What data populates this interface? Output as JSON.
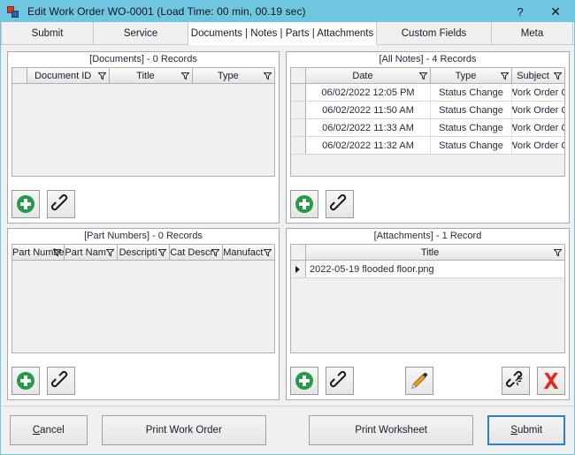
{
  "window": {
    "title": "Edit Work Order WO-0001 (Load Time: 00 min, 00.19 sec)",
    "help_label": "?",
    "close_label": "✕",
    "titlebar_color": "#6fc6e0"
  },
  "tabs": [
    {
      "label": "Submit",
      "active": false
    },
    {
      "label": "Service",
      "active": false
    },
    {
      "label": "Documents | Notes | Parts | Attachments",
      "active": true
    },
    {
      "label": "Custom Fields",
      "active": false
    },
    {
      "label": "Meta",
      "active": false
    }
  ],
  "panels": {
    "documents": {
      "title": "[Documents] - 0 Records",
      "columns": [
        "Document ID",
        "Title",
        "Type"
      ],
      "rows": [],
      "toolbar": [
        {
          "name": "add-button",
          "icon": "plus-circle-icon"
        },
        {
          "name": "link-button",
          "icon": "link-icon"
        }
      ]
    },
    "notes": {
      "title": "[All Notes] - 4 Records",
      "columns": [
        "Date",
        "Type",
        "Subject"
      ],
      "rows": [
        [
          "06/02/2022 12:05 PM",
          "Status Change",
          "Work Order C"
        ],
        [
          "06/02/2022 11:50 AM",
          "Status Change",
          "Work Order C"
        ],
        [
          "06/02/2022 11:33 AM",
          "Status Change",
          "Work Order C"
        ],
        [
          "06/02/2022 11:32 AM",
          "Status Change",
          "Work Order C"
        ]
      ],
      "toolbar": [
        {
          "name": "add-button",
          "icon": "plus-circle-icon"
        },
        {
          "name": "link-button",
          "icon": "link-icon"
        }
      ]
    },
    "parts": {
      "title": "[Part Numbers] - 0 Records",
      "columns": [
        "Part Numbe",
        "Part Nam",
        "Descripti",
        "Cat Descr",
        "Manufact"
      ],
      "rows": [],
      "toolbar": [
        {
          "name": "add-button",
          "icon": "plus-circle-icon"
        },
        {
          "name": "link-button",
          "icon": "link-icon"
        }
      ]
    },
    "attachments": {
      "title": "[Attachments] - 1 Record",
      "columns": [
        "Title"
      ],
      "rows": [
        [
          "2022-05-19 flooded floor.png"
        ]
      ],
      "toolbar": [
        {
          "name": "add-button",
          "icon": "plus-circle-icon"
        },
        {
          "name": "link-button",
          "icon": "link-icon"
        },
        {
          "name": "edit-button",
          "icon": "pencil-icon"
        },
        {
          "name": "unlink-button",
          "icon": "broken-link-icon"
        },
        {
          "name": "delete-button",
          "icon": "red-x-icon"
        }
      ]
    }
  },
  "footer": {
    "cancel": "Cancel",
    "cancel_accel": "C",
    "cancel_rest": "ancel",
    "print_work_order": "Print Work Order",
    "print_worksheet": "Print Worksheet",
    "submit": "Submit",
    "submit_accel": "S",
    "submit_rest": "ubmit"
  },
  "colors": {
    "accent": "#6fc6e0",
    "add_green": "#259b4a",
    "delete_red": "#e02b20",
    "pencil_orange": "#f0a11e",
    "default_button_border": "#2f7fd0"
  }
}
